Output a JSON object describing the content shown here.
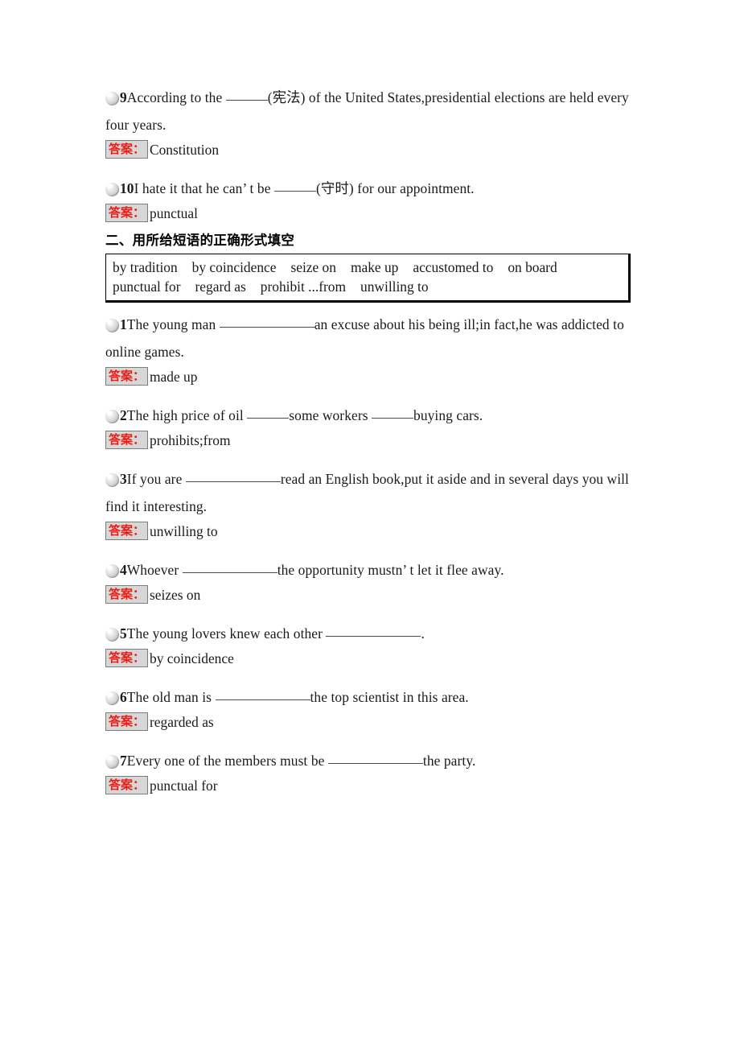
{
  "section_one_tail": {
    "questions": [
      {
        "number": "9",
        "text_before": "According to the ",
        "hint": "(宪法)",
        "text_after": " of the United States,presidential elections are held every four years.",
        "answer_label": "答案：",
        "answer": "Constitution"
      },
      {
        "number": "10",
        "text_before": "I hate it that he can’ t be ",
        "hint": "(守时)",
        "text_after": " for our appointment.",
        "answer_label": "答案：",
        "answer": "punctual"
      }
    ]
  },
  "section_two": {
    "heading": "二、用所给短语的正确形式填空",
    "phrase_bank": {
      "row1": [
        "by tradition",
        "by coincidence",
        "seize on",
        "make up",
        "accustomed to",
        "on board"
      ],
      "row2": [
        "punctual for",
        "regard as",
        "prohibit ...from",
        "unwilling to"
      ]
    },
    "questions": [
      {
        "number": "1",
        "part1": "The young man ",
        "part2": "an excuse about his being ill;in fact,he was addicted to online games.",
        "answer_label": "答案：",
        "answer": "made up"
      },
      {
        "number": "2",
        "part1": "The high price of oil ",
        "part2": "some workers ",
        "part3": "buying cars.",
        "answer_label": "答案：",
        "answer": "prohibits;from"
      },
      {
        "number": "3",
        "part1": "If you are ",
        "part2": "read an English book,put it aside and in several days you will find it interesting.",
        "answer_label": "答案：",
        "answer": "unwilling to"
      },
      {
        "number": "4",
        "part1": "Whoever ",
        "part2": "the opportunity mustn’ t let it flee away.",
        "answer_label": "答案：",
        "answer": "seizes on"
      },
      {
        "number": "5",
        "part1": "The young lovers knew each other ",
        "part2": ".",
        "answer_label": "答案：",
        "answer": "by coincidence"
      },
      {
        "number": "6",
        "part1": "The old man is ",
        "part2": "the top scientist in this area.",
        "answer_label": "答案：",
        "answer": "regarded as"
      },
      {
        "number": "7",
        "part1": "Every one of the members must be ",
        "part2": "the party.",
        "answer_label": "答案：",
        "answer": "punctual for"
      }
    ]
  }
}
